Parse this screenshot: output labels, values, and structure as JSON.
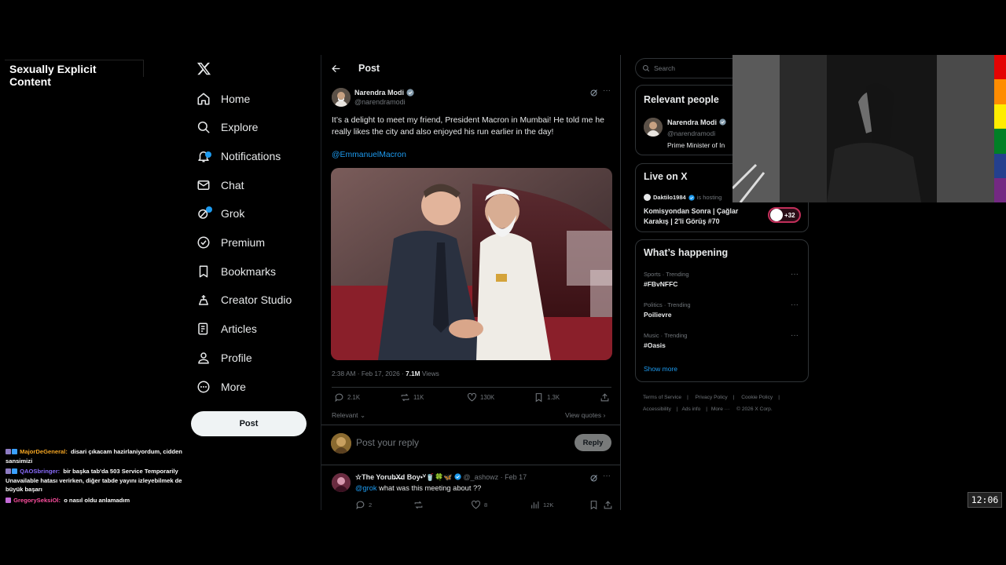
{
  "overlay": {
    "label": "Sexually Explicit Content"
  },
  "nav": {
    "items": [
      {
        "label": "Home",
        "icon": "home-icon"
      },
      {
        "label": "Explore",
        "icon": "search-icon"
      },
      {
        "label": "Notifications",
        "icon": "bell-icon"
      },
      {
        "label": "Chat",
        "icon": "mail-icon"
      },
      {
        "label": "Grok",
        "icon": "grok-icon"
      },
      {
        "label": "Premium",
        "icon": "verified-icon"
      },
      {
        "label": "Bookmarks",
        "icon": "bookmark-icon"
      },
      {
        "label": "Creator Studio",
        "icon": "creator-icon"
      },
      {
        "label": "Articles",
        "icon": "article-icon"
      },
      {
        "label": "Profile",
        "icon": "person-icon"
      },
      {
        "label": "More",
        "icon": "more-circle-icon"
      }
    ],
    "post_label": "Post"
  },
  "chat": [
    {
      "user": "MajorDeGeneral:",
      "user_color": "#f5a623",
      "text": "disari çıkacam hazirlaniyordum, cidden sansimizi"
    },
    {
      "user": "QAOSbringer:",
      "user_color": "#8a6cff",
      "text": "bir başka tab'da 503 Service Temporarily Unavailable hatası verirken, diğer tabde yayını izleyebilmek de büyük başarı"
    },
    {
      "user": "GregorySeksiOl:",
      "user_color": "#ff4fa0",
      "text": "o nasıl oldu anlamadım"
    }
  ],
  "header": {
    "title": "Post"
  },
  "tweet": {
    "author": "Narendra Modi",
    "handle": "@narendramodi",
    "text": "It’s a delight to meet my friend, President Macron in Mumbai! He told me he really likes the city and also enjoyed his run earlier in the day!",
    "mention": "@EmmanuelMacron",
    "time": "2:38 AM · Feb 17, 2026 · ",
    "views_count": "7.1M",
    "views_label": " Views",
    "replies": "2.1K",
    "reposts": "11K",
    "likes": "130K",
    "bookmarks": "1.3K"
  },
  "sort": {
    "relevant": "Relevant",
    "view_quotes": "View quotes"
  },
  "reply_box": {
    "placeholder": "Post your reply",
    "button": "Reply"
  },
  "reply": {
    "name": "☆The Yorub̶X̶d Boy•ⱽ🥤🍀🦋",
    "meta": "@_ashowz · Feb 17",
    "mention": "@grok",
    "text": " what was this meeting about ??",
    "replies": "2",
    "likes": "8",
    "views": "12K"
  },
  "search": {
    "placeholder": "Search"
  },
  "relevant_people": {
    "title": "Relevant people",
    "name": "Narendra Modi",
    "handle": "@narendramodi",
    "bio": "Prime Minister of In"
  },
  "live": {
    "title": "Live on X",
    "host": "Daktilo1984",
    "hosting": "is hosting",
    "space_title": "Komisyondan Sonra | Çağlar Karakış | 2'li Görüş #70",
    "listeners": "+32"
  },
  "happening": {
    "title": "What’s happening",
    "trends": [
      {
        "category": "Sports · Trending",
        "name": "#FBvNFFC"
      },
      {
        "category": "Politics · Trending",
        "name": "Poilievre"
      },
      {
        "category": "Music · Trending",
        "name": "#Oasis"
      }
    ],
    "show_more": "Show more"
  },
  "footer": [
    "Terms of Service",
    "Privacy Policy",
    "Cookie Policy",
    "Accessibility",
    "Ads info",
    "More ···",
    "© 2026 X Corp."
  ],
  "clock": "12:06",
  "colors": {
    "accent": "#1d9bf0",
    "background": "#000000",
    "border": "#2f3336",
    "muted": "#71767b"
  }
}
